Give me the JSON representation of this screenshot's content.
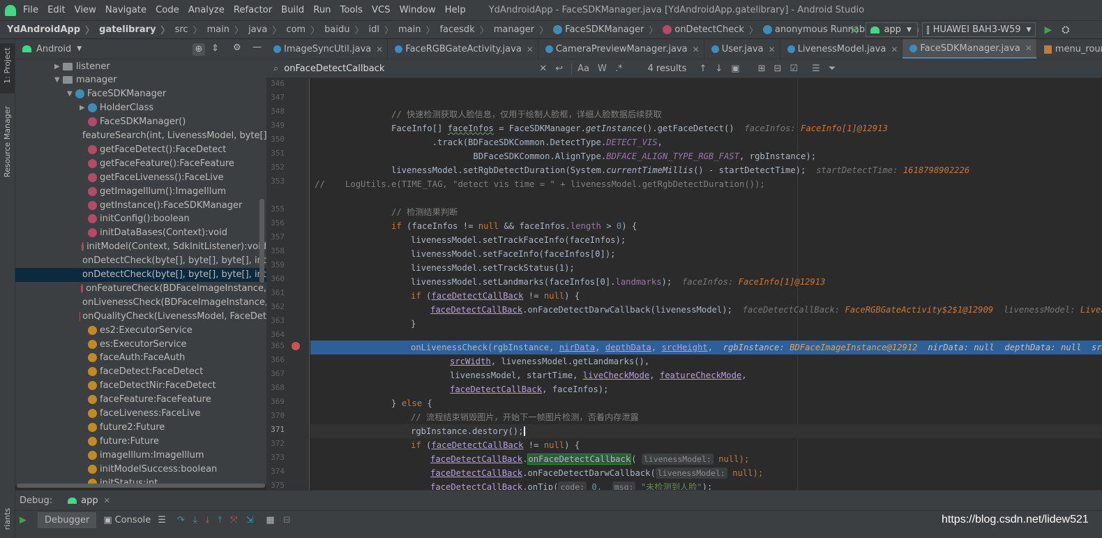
{
  "menubar": {
    "items": [
      "File",
      "Edit",
      "View",
      "Navigate",
      "Code",
      "Analyze",
      "Refactor",
      "Build",
      "Run",
      "Tools",
      "VCS",
      "Window",
      "Help"
    ],
    "title": "YdAndroidApp - FaceSDKManager.java [YdAndroidApp.gatelibrary] - Android Studio"
  },
  "breadcrumbs": [
    "YdAndroidApp",
    "gatelibrary",
    "src",
    "main",
    "java",
    "com",
    "baidu",
    "idl",
    "main",
    "facesdk",
    "manager",
    "FaceSDKManager",
    "onDetectCheck",
    "anonymous Runnable",
    "run"
  ],
  "run_config": "app",
  "device": "HUAWEI BAH3-W59",
  "side_labels": {
    "project": "1: Project",
    "resource_manager": "Resource Manager",
    "variants": "riants"
  },
  "project_view": "Android",
  "tree": [
    {
      "label": "listener",
      "kind": "folder",
      "level": 0,
      "arrow": "▶"
    },
    {
      "label": "manager",
      "kind": "folder",
      "level": 0,
      "arrow": "▼"
    },
    {
      "label": "FaceSDKManager",
      "kind": "class",
      "level": 1,
      "arrow": "▼"
    },
    {
      "label": "HolderClass",
      "kind": "class",
      "level": 2,
      "arrow": "▶"
    },
    {
      "label": "FaceSDKManager()",
      "kind": "method",
      "level": 2
    },
    {
      "label": "featureSearch(int, LivenessModel, byte[],",
      "kind": "method",
      "level": 2
    },
    {
      "label": "getFaceDetect():FaceDetect",
      "kind": "method",
      "level": 2
    },
    {
      "label": "getFaceFeature():FaceFeature",
      "kind": "method",
      "level": 2
    },
    {
      "label": "getFaceLiveness():FaceLive",
      "kind": "method",
      "level": 2
    },
    {
      "label": "getImageIllum():ImageIllum",
      "kind": "method",
      "level": 2
    },
    {
      "label": "getInstance():FaceSDKManager",
      "kind": "method",
      "level": 2
    },
    {
      "label": "initConfig():boolean",
      "kind": "method",
      "level": 2
    },
    {
      "label": "initDataBases(Context):void",
      "kind": "method",
      "level": 2
    },
    {
      "label": "initModel(Context, SdkInitListener):void",
      "kind": "method",
      "level": 2
    },
    {
      "label": "onDetectCheck(byte[], byte[], byte[], int,",
      "kind": "method",
      "level": 2
    },
    {
      "label": "onDetectCheck(byte[], byte[], byte[], int,",
      "kind": "method",
      "level": 2,
      "selected": true
    },
    {
      "label": "onFeatureCheck(BDFaceImageInstance,",
      "kind": "method",
      "level": 2
    },
    {
      "label": "onLivenessCheck(BDFaceImageInstance,",
      "kind": "method",
      "level": 2
    },
    {
      "label": "onQualityCheck(LivenessModel, FaceDet",
      "kind": "method",
      "level": 2
    },
    {
      "label": "es2:ExecutorService",
      "kind": "field",
      "level": 2
    },
    {
      "label": "es:ExecutorService",
      "kind": "field",
      "level": 2
    },
    {
      "label": "faceAuth:FaceAuth",
      "kind": "field",
      "level": 2
    },
    {
      "label": "faceDetect:FaceDetect",
      "kind": "field",
      "level": 2
    },
    {
      "label": "faceDetectNir:FaceDetect",
      "kind": "field",
      "level": 2
    },
    {
      "label": "faceFeature:FaceFeature",
      "kind": "field",
      "level": 2
    },
    {
      "label": "faceLiveness:FaceLive",
      "kind": "field",
      "level": 2
    },
    {
      "label": "future2:Future",
      "kind": "field",
      "level": 2
    },
    {
      "label": "future:Future",
      "kind": "field",
      "level": 2
    },
    {
      "label": "imageIllum:ImageIllum",
      "kind": "field",
      "level": 2
    },
    {
      "label": "initModelSuccess:boolean",
      "kind": "field",
      "level": 2
    },
    {
      "label": "initStatus:int",
      "kind": "field",
      "level": 2
    }
  ],
  "tabs": [
    {
      "label": "ImageSyncUtil.java"
    },
    {
      "label": "FaceRGBGateActivity.java"
    },
    {
      "label": "CameraPreviewManager.java"
    },
    {
      "label": "User.java"
    },
    {
      "label": "LivenessModel.java"
    },
    {
      "label": "FaceSDKManager.java",
      "active": true
    },
    {
      "label": "menu_round_frist.xml"
    }
  ],
  "search": {
    "query": "onFaceDetectCallback",
    "results": "4 results"
  },
  "line_numbers": [
    "346",
    "347",
    "348",
    "349",
    "350",
    "351",
    "352",
    "353",
    "355",
    "356",
    "357",
    "358",
    "359",
    "360",
    "361",
    "362",
    "363",
    "364",
    "365",
    "366",
    "367",
    "368",
    "369",
    "370",
    "371",
    "372",
    "373",
    "374",
    "375"
  ],
  "code": {
    "l348": "// 快速检测获取人脸信息，仅用于绘制人脸框，详细人脸数据后续获取",
    "l349_a": "FaceInfo[] ",
    "l349_b": "faceInfos",
    " l349_c": "",
    "l349_d": " = FaceSDKManager.",
    "l349_e": "getInstance",
    "l349_f": "().getFaceDetect()",
    "l349_h1": "faceInfos: ",
    "l349_h2": "FaceInfo[1]@12913",
    "l350_a": "        .track(BDFaceSDKCommon.DetectType.",
    "l350_b": "DETECT_VIS",
    "l351_a": "                BDFaceSDKCommon.AlignType.",
    "l351_b": "BDFACE_ALIGN_TYPE_RGB_FAST",
    ", rgbInstance);": "",
    "l352_a": "livenessModel.setRgbDetectDuration(System.",
    "l352_b": "currentTimeMillis",
    "l352_c": "() - startDetectTime);",
    "l352_h1": "startDetectTime: ",
    "l352_h2": "1618798902226",
    "l353": "//    LogUtils.e(TIME_TAG, \"detect vis time = \" + livenessModel.getRgbDetectDuration());",
    "l355": "// 检测结果判断",
    "l356_a": "if",
    " l356_b": "",
    "l356_c": " (faceInfos != ",
    "l356_d": "null",
    " l356_e": "",
    "l356_f": " && faceInfos.",
    "l356_g": "length",
    "l356_h": " > ",
    "l356_i": "0",
    ") {": "",
    "l357": "livenessModel.setTrackFaceInfo(faceInfos);",
    "l358": "livenessModel.setFaceInfo(faceInfos[0]);",
    "l359": "livenessModel.setTrackStatus(1);",
    "l360_a": "livenessModel.setLandmarks(faceInfos[0].",
    "l360_b": "landmarks",
    "l360_c": ");",
    "l360_h1": "faceInfos: ",
    "l360_h2": "FaceInfo[1]@12913",
    "l361_a": "if (",
    "l361_b": "faceDetectCallBack",
    "l361_c": " != null) {",
    "l362_a": "faceDetectCallBack",
    ".onFaceDetectDarwCallback(livenessModel);": "",
    "l362_b": ".onFaceDetectDarwCallback(livenessModel);",
    "l362_h1": "faceDetectCallBack: ",
    "l362_h2": "FaceRGBGateActivity$2$1@12909",
    "l362_h3": "livenessModel: ",
    "l362_h4": "LivenessMo",
    "l363": "}",
    "l365_a": "onLivenessCheck(rgbInstance, ",
    "l365_b": "nirData",
    ", ": "",
    "l365_c": "depthData",
    "l365_d": "srcHeight",
    "l365_h1": "rgbInstance: ",
    "l365_h2": "BDFaceImageInstance@12912",
    "l365_h3": "nirData: null",
    "l365_h4": "depthData: null",
    "l365_h5": "srcHeigh",
    "l366_a": "srcWidth",
    "l366_b": ", livenessModel.getLandmarks(),",
    "l367_a": "livenessModel, startTime, ",
    "l367_b": "liveCheckMode",
    "l367_c": "featureCheckMode",
    "l368_a": "faceDetectCallBack",
    "l368_b": ", faceInfos);",
    "l369": "} else {",
    "l370": "// 流程结束销毁图片，开始下一帧图片检测，否着内存泄露",
    "l371": "rgbInstance.destory();",
    "l372_a": "if (",
    "l372_b": "faceDetectCallBack",
    "l372_c": " != null) {",
    "l373_a": "faceDetectCallBack",
    ".": "",
    "l373_b": "onFaceDetectCallback",
    "l373_c": "(",
    "l373_p": "livenessModel:",
    "l373_d": " null);",
    "l374_a": "faceDetectCallBack",
    "l374_b": ".onFaceDetectDarwCallback(",
    "l374_p": "livenessModel:",
    "l374_d": " null);",
    "l375_a": "faceDetectCallBack",
    "l375_b": ".onTip(",
    "l375_p1": "code:",
    "l375_c": " 0, ",
    "l375_p2": "msg:",
    "l375_d": "\"未检测到人脸\"",
    "l375_e": ");"
  },
  "bottom": {
    "debug_label": "Debug:",
    "session": "app",
    "tab_debugger": "Debugger",
    "tab_console": "Console",
    "watermark": "https://blog.csdn.net/lidew521"
  },
  "colors": {
    "keyword": "#cc7832",
    "comment": "#808080",
    "string": "#6a8759",
    "number": "#6897bb",
    "field": "#9876aa",
    "selection": "#2d6099"
  }
}
